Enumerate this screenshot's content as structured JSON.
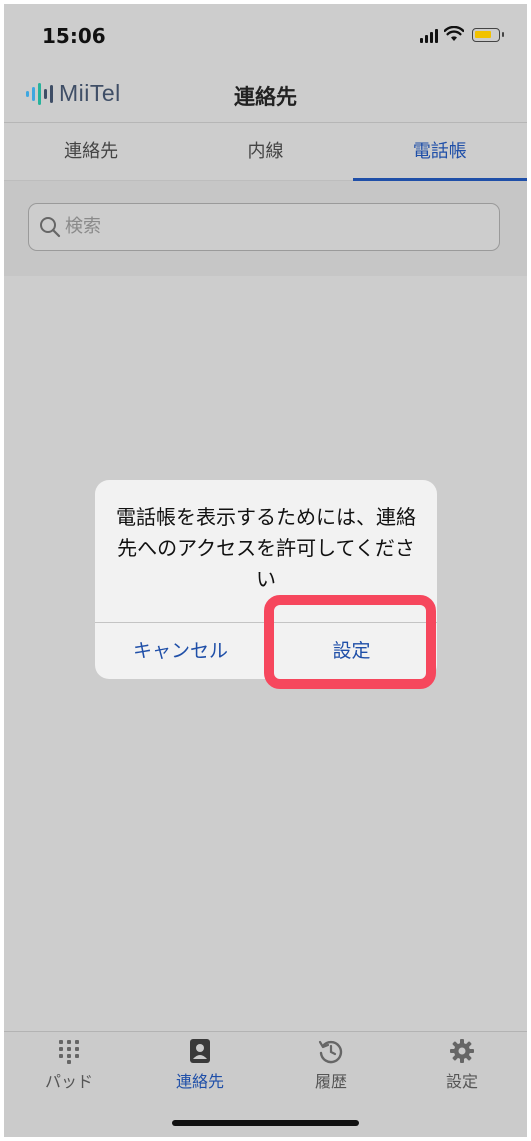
{
  "status_bar": {
    "time": "15:06"
  },
  "header": {
    "logo_text": "MiiTel",
    "title": "連絡先"
  },
  "tabs": [
    {
      "label": "連絡先",
      "active": false
    },
    {
      "label": "内線",
      "active": false
    },
    {
      "label": "電話帳",
      "active": true
    }
  ],
  "search": {
    "placeholder": "検索",
    "value": ""
  },
  "dialog": {
    "message": "電話帳を表示するためには、連絡先へのアクセスを許可してください",
    "cancel_label": "キャンセル",
    "settings_label": "設定"
  },
  "tabbar": {
    "items": [
      {
        "label": "パッド",
        "icon": "keypad-icon",
        "active": false
      },
      {
        "label": "連絡先",
        "icon": "contacts-icon",
        "active": true
      },
      {
        "label": "履歴",
        "icon": "history-icon",
        "active": false
      },
      {
        "label": "設定",
        "icon": "gear-icon",
        "active": false
      }
    ]
  },
  "colors": {
    "accent": "#1f4fa8",
    "highlight": "#f6475d",
    "overlay": "#cdcdcd"
  }
}
